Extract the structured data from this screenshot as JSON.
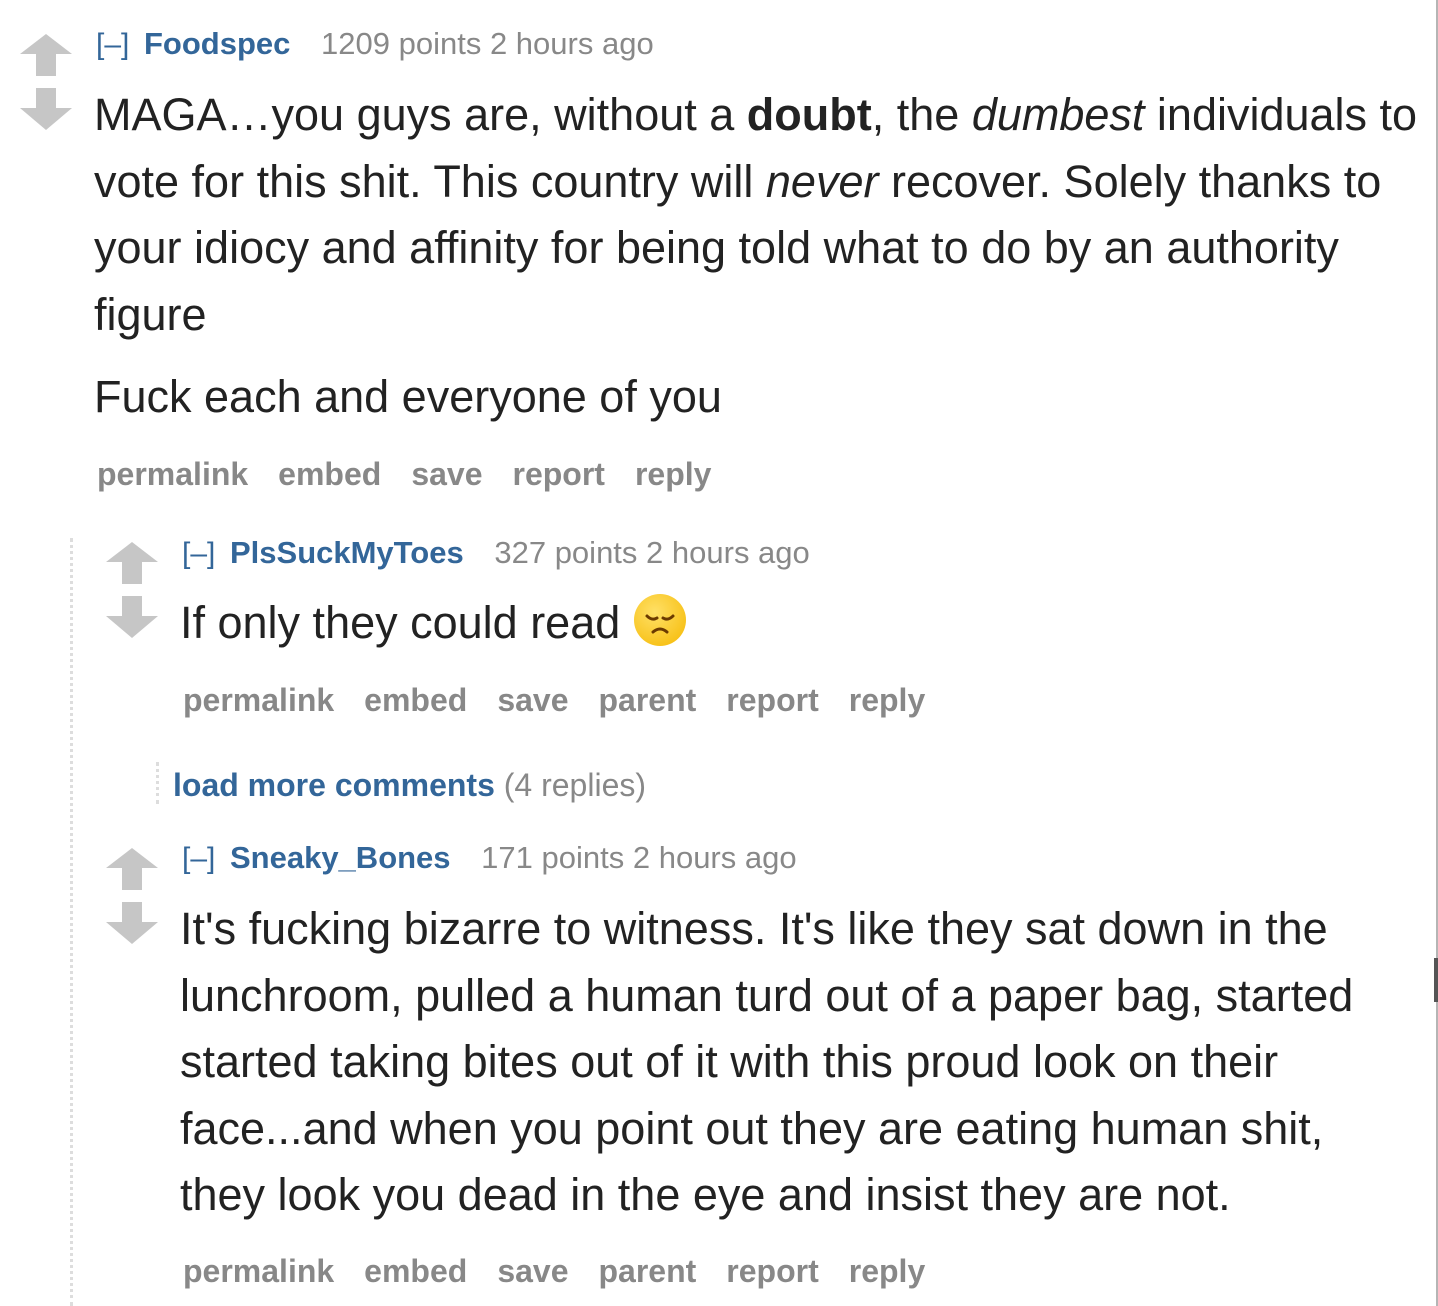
{
  "comments": {
    "c1": {
      "collapse": "[–]",
      "author": "Foodspec",
      "score": "1209 points",
      "time": "2 hours ago",
      "body": {
        "p1_a": "MAGA…you guys are, without a ",
        "p1_b": "doubt",
        "p1_c": ", the ",
        "p1_d": "dumbest",
        "p1_e": " individuals to vote for this shit. This country will ",
        "p1_f": "never",
        "p1_g": " recover. Solely thanks to your idiocy and affinity for being told what to do by an authority figure",
        "p2": "Fuck each and everyone of you"
      },
      "buttons": [
        "permalink",
        "embed",
        "save",
        "report",
        "reply"
      ]
    },
    "c2": {
      "collapse": "[–]",
      "author": "PlsSuckMyToes",
      "score": "327 points",
      "time": "2 hours ago",
      "body": "If only they could read",
      "emoji": "disappointed-face",
      "buttons": [
        "permalink",
        "embed",
        "save",
        "parent",
        "report",
        "reply"
      ]
    },
    "load_more": {
      "link": "load more comments",
      "count": "(4 replies)"
    },
    "c3": {
      "collapse": "[–]",
      "author": "Sneaky_Bones",
      "score": "171 points",
      "time": "2 hours ago",
      "body": "It's fucking bizarre to witness. It's like they sat down in the lunchroom, pulled a human turd out of a paper bag, started started taking bites out of it with this proud look on their face...and when you point out they are eating human shit, they look you dead in the eye and insist they are not.",
      "buttons": [
        "permalink",
        "embed",
        "save",
        "parent",
        "report",
        "reply"
      ]
    }
  },
  "colors": {
    "link": "#336699",
    "muted": "#888888",
    "text": "#222222",
    "arrow": "#c6c6c6"
  }
}
